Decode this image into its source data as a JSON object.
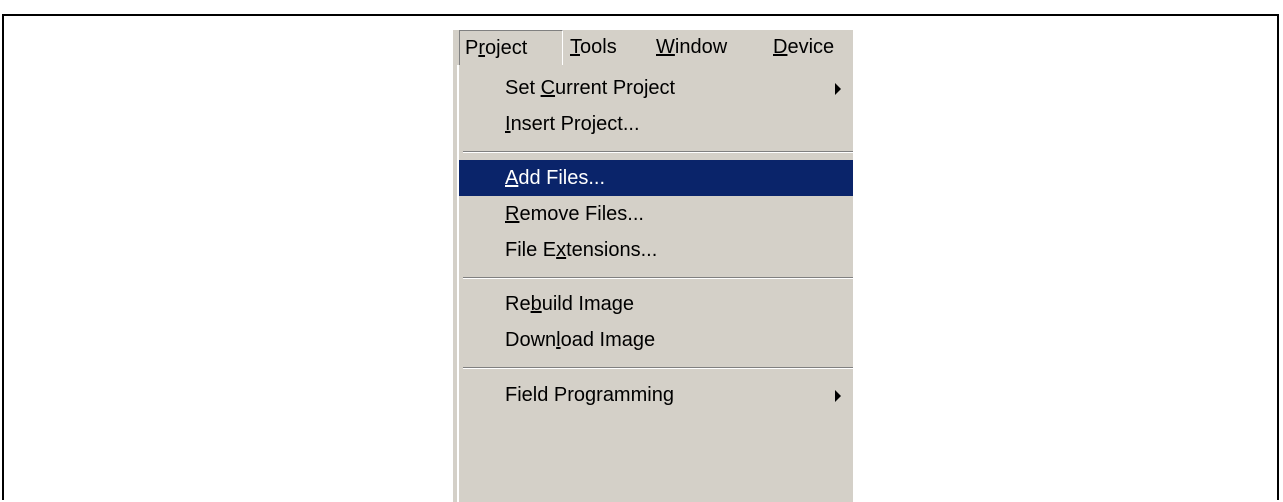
{
  "menubar": {
    "items": [
      {
        "pre": "P",
        "ul": "r",
        "post": "oject"
      },
      {
        "pre": "",
        "ul": "T",
        "post": "ools"
      },
      {
        "pre": "",
        "ul": "W",
        "post": "indow"
      },
      {
        "pre": "",
        "ul": "D",
        "post": "evice"
      }
    ]
  },
  "menu": {
    "items": [
      {
        "pre": "Set ",
        "ul": "C",
        "post": "urrent Project",
        "submenu": true
      },
      {
        "pre": "",
        "ul": "I",
        "post": "nsert Project..."
      },
      {
        "pre": "",
        "ul": "A",
        "post": "dd Files...",
        "selected": true
      },
      {
        "pre": "",
        "ul": "R",
        "post": "emove Files..."
      },
      {
        "pre": "File E",
        "ul": "x",
        "post": "tensions..."
      },
      {
        "pre": "Re",
        "ul": "b",
        "post": "uild Image"
      },
      {
        "pre": "Down",
        "ul": "l",
        "post": "oad Image"
      },
      {
        "pre": "Field Programming",
        "ul": "",
        "post": "",
        "submenu": true
      }
    ]
  },
  "colors": {
    "menu_background": "#d4d0c8",
    "selection_background": "#0a246a",
    "selection_text": "#ffffff"
  }
}
